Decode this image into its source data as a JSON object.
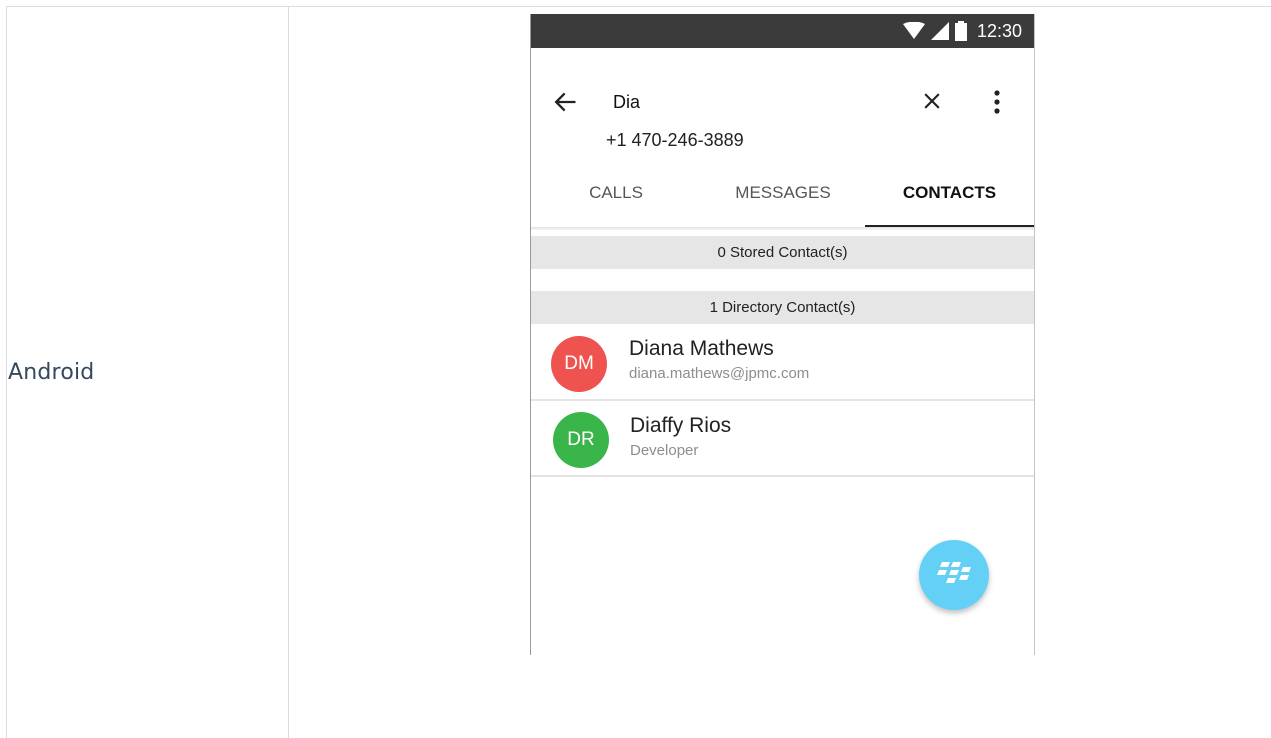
{
  "table": {
    "platform_label": "Android"
  },
  "status_bar": {
    "time": "12:30",
    "icons": [
      "wifi-icon",
      "signal-icon",
      "battery-icon"
    ]
  },
  "app_bar": {
    "search_query": "Dia",
    "phone_number": "+1 470-246-3889",
    "icons": [
      "back-arrow-icon",
      "close-icon",
      "more-vert-icon"
    ]
  },
  "tabs": [
    {
      "label": "CALLS",
      "active": false
    },
    {
      "label": "MESSAGES",
      "active": false
    },
    {
      "label": "CONTACTS",
      "active": true
    }
  ],
  "sections": {
    "stored": "0 Stored Contact(s)",
    "directory": "1 Directory Contact(s)"
  },
  "contacts": [
    {
      "initials": "DM",
      "name": "Diana Mathews",
      "subtitle": "diana.mathews@jpmc.com",
      "avatar_color": "#ef5350"
    },
    {
      "initials": "DR",
      "name": "Diaffy Rios",
      "subtitle": "Developer",
      "avatar_color": "#3ab54a"
    }
  ],
  "fab": {
    "icon": "blackberry-icon",
    "color": "#64d0f5"
  }
}
